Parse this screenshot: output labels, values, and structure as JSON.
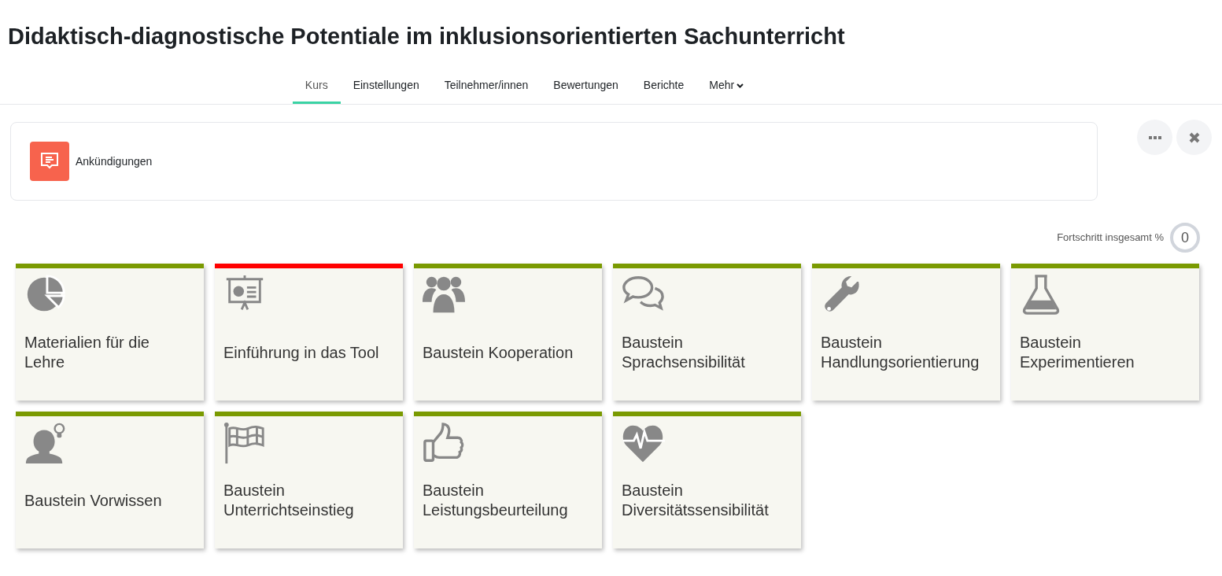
{
  "title": "Didaktisch-diagnostische Potentiale im inklusionsorientierten Sachunterricht",
  "tabs": [
    {
      "label": "Kurs",
      "selected": true,
      "dropdown": false
    },
    {
      "label": "Einstellungen",
      "selected": false,
      "dropdown": false
    },
    {
      "label": "Teilnehmer/innen",
      "selected": false,
      "dropdown": false
    },
    {
      "label": "Bewertungen",
      "selected": false,
      "dropdown": false
    },
    {
      "label": "Berichte",
      "selected": false,
      "dropdown": false
    },
    {
      "label": "Mehr",
      "selected": false,
      "dropdown": true
    }
  ],
  "announcement": {
    "label": "Ankündigungen"
  },
  "progress": {
    "label": "Fortschritt insgesamt %",
    "value": "0"
  },
  "tiles": [
    {
      "title": "Materialien für die Lehre",
      "kind": "pie",
      "color": "#7a9a01"
    },
    {
      "title": "Einführung in das Tool",
      "kind": "presentation",
      "color": "#ff0000"
    },
    {
      "title": "Baustein Kooperation",
      "kind": "users",
      "color": "#7a9a01"
    },
    {
      "title": "Baustein Sprachsensibilität",
      "kind": "comments",
      "color": "#7a9a01"
    },
    {
      "title": "Baustein Handlungsorientierung",
      "kind": "wrench",
      "color": "#7a9a01"
    },
    {
      "title": "Baustein Experimentieren",
      "kind": "flask",
      "color": "#7a9a01"
    },
    {
      "title": "Baustein Vorwissen",
      "kind": "idea",
      "color": "#7a9a01"
    },
    {
      "title": "Baustein Unterrichtseinstieg",
      "kind": "flag",
      "color": "#7a9a01"
    },
    {
      "title": "Baustein Leistungsbeurteilung",
      "kind": "thumb",
      "color": "#7a9a01"
    },
    {
      "title": "Baustein Diversitätssensibilität",
      "kind": "heartbeat",
      "color": "#7a9a01"
    }
  ]
}
